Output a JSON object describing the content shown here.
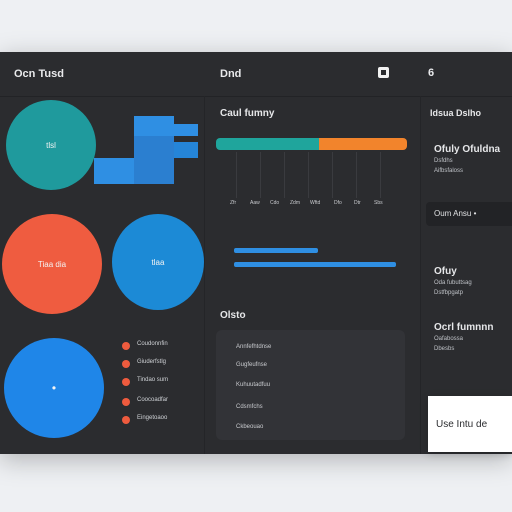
{
  "header": {
    "title_left": "Ocn Tusd",
    "title_mid": "Dnd",
    "right_icon": "square-stop-icon",
    "right_num": "6"
  },
  "left": {
    "circle_teal_label": "tlsl",
    "circle_red_label": "Tiaa dia",
    "circle_blue_label": "tlaa",
    "circle_bottom_label": "•",
    "legend": [
      "Coudonnfin",
      "Giuderfstlg",
      "Tindao sum",
      "Coocoadfar",
      "Eingetoaoo"
    ],
    "colors": {
      "teal": "#1f9a9d",
      "red": "#ef5c40",
      "blue": "#1c8ad6"
    }
  },
  "middle": {
    "title": "Caul fumny",
    "axis_labels": [
      "Zfr",
      "Aaw",
      "Cdo",
      "Zdm",
      "Wftd",
      "Dfo",
      "Dtr",
      "Sbs"
    ],
    "section_title": "Olsto",
    "list": [
      "Annfefhtdnse",
      "Gugfeufnse",
      "Kuhuutadfuu",
      "Cdsmfchs",
      "Ckbeouao"
    ]
  },
  "right": {
    "title": "Idsua Dslho",
    "block1": {
      "head": "Ofuly Ofuldna",
      "line1": "Dsfdhs",
      "line2": "Aifbsfaloss"
    },
    "button": "Oum Ansu •",
    "block2": {
      "head": "Ofuy",
      "line1": "Oda fubuttsag",
      "line2": "Dstfbpgatp"
    },
    "block3": {
      "head": "Ocrl fumnnn",
      "line1": "Oafabossa",
      "line2": "Dbesbs"
    }
  },
  "popup": {
    "label": "Use Intu de"
  }
}
